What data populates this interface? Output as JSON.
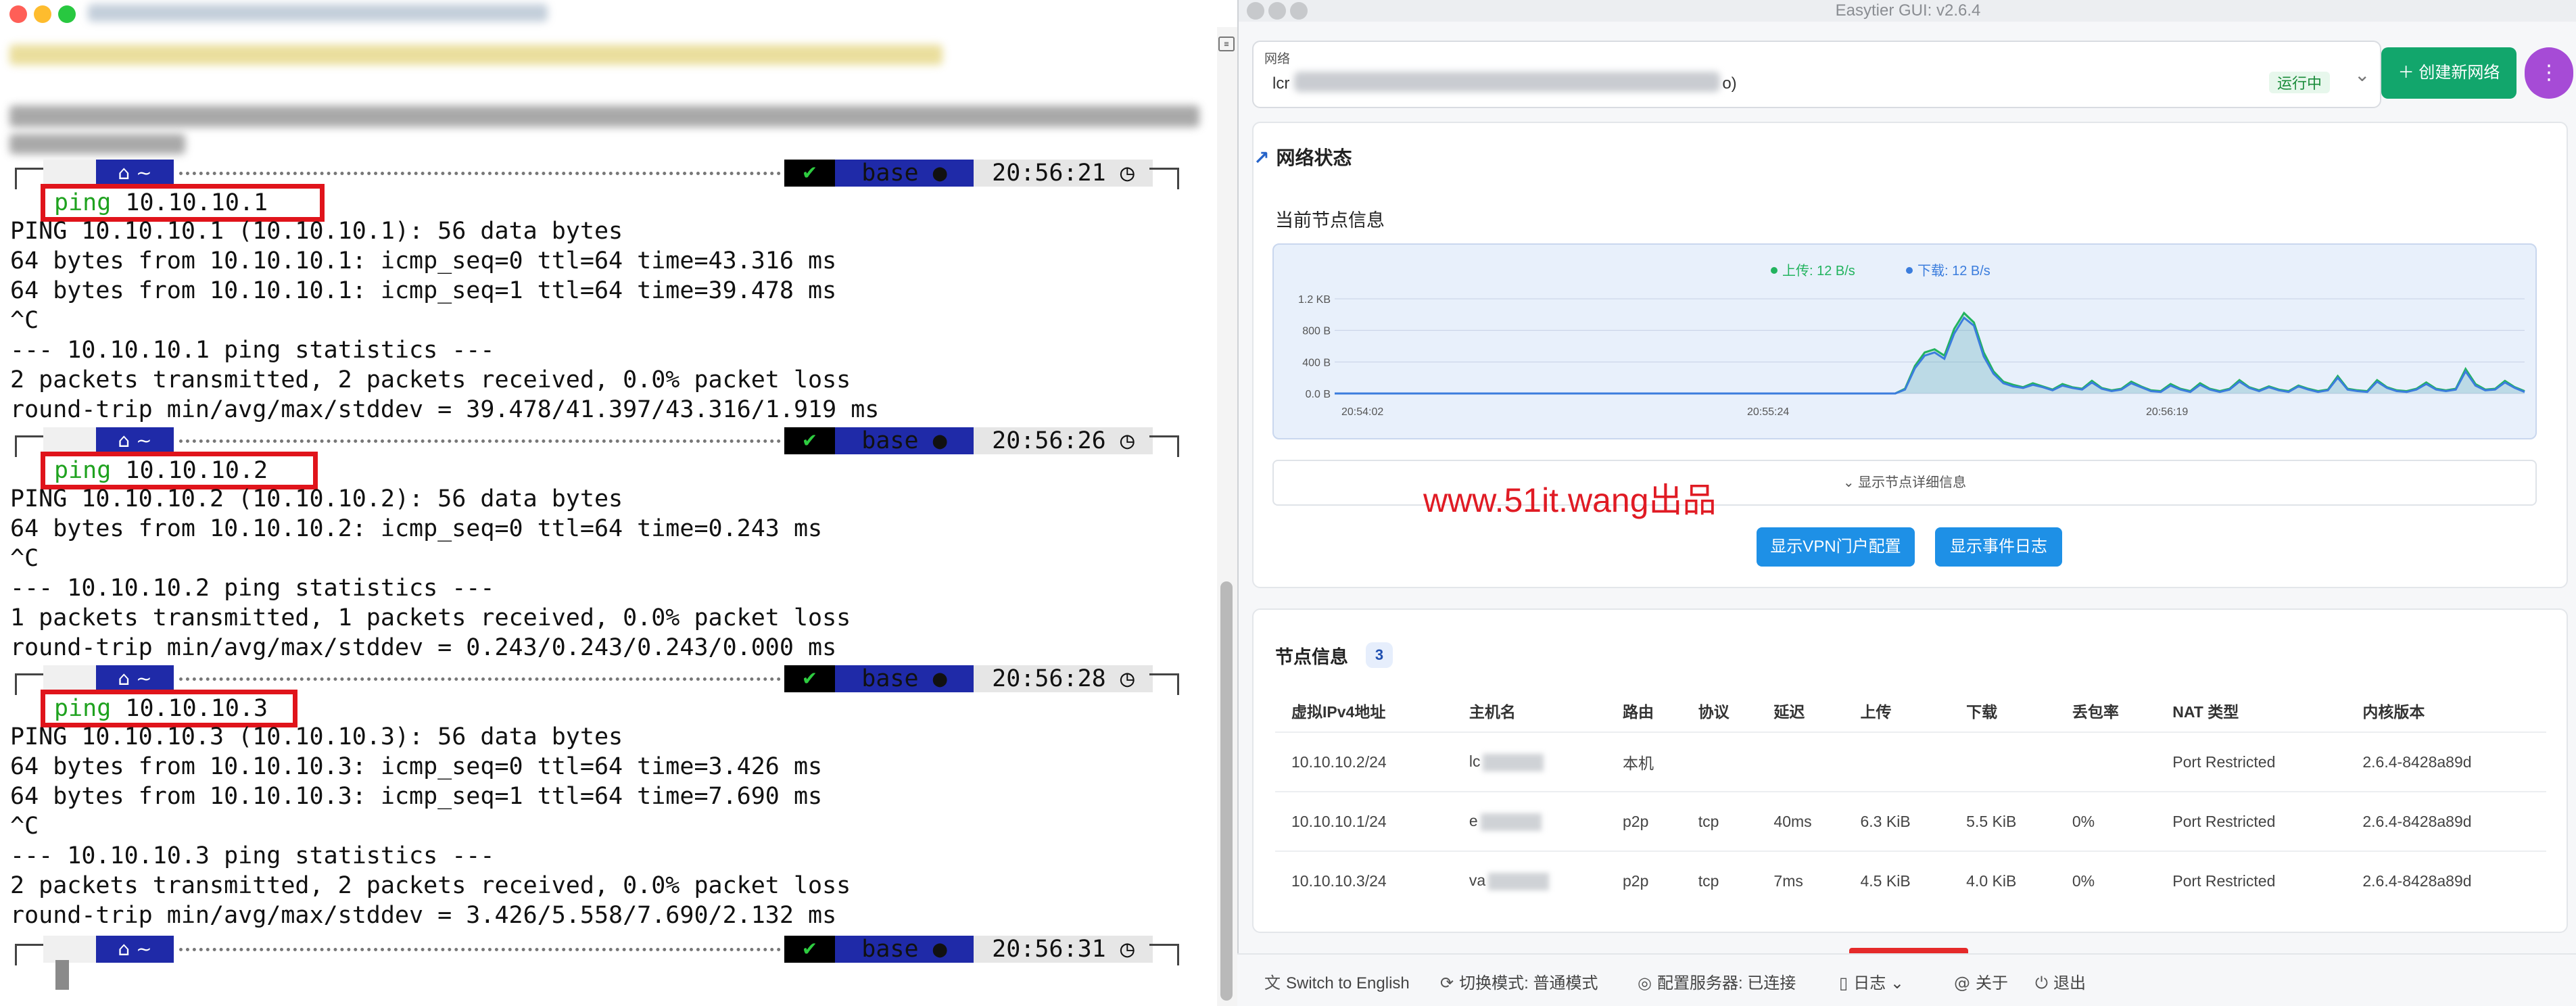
{
  "terminal": {
    "blocks": [
      {
        "time": "20:56:21",
        "cmd_kw": "ping",
        "cmd_arg": "10.10.10.1",
        "output": [
          "PING 10.10.10.1 (10.10.10.1): 56 data bytes",
          "64 bytes from 10.10.10.1: icmp_seq=0 ttl=64 time=43.316 ms",
          "64 bytes from 10.10.10.1: icmp_seq=1 ttl=64 time=39.478 ms",
          "^C",
          "--- 10.10.10.1 ping statistics ---",
          "2 packets transmitted, 2 packets received, 0.0% packet loss",
          "round-trip min/avg/max/stddev = 39.478/41.397/43.316/1.919 ms"
        ]
      },
      {
        "time": "20:56:26",
        "cmd_kw": "ping",
        "cmd_arg": "10.10.10.2",
        "output": [
          "PING 10.10.10.2 (10.10.10.2): 56 data bytes",
          "64 bytes from 10.10.10.2: icmp_seq=0 ttl=64 time=0.243 ms",
          "^C",
          "--- 10.10.10.2 ping statistics ---",
          "1 packets transmitted, 1 packets received, 0.0% packet loss",
          "round-trip min/avg/max/stddev = 0.243/0.243/0.243/0.000 ms"
        ]
      },
      {
        "time": "20:56:28",
        "cmd_kw": "ping",
        "cmd_arg": "10.10.10.3",
        "output": [
          "PING 10.10.10.3 (10.10.10.3): 56 data bytes",
          "64 bytes from 10.10.10.3: icmp_seq=0 ttl=64 time=3.426 ms",
          "64 bytes from 10.10.10.3: icmp_seq=1 ttl=64 time=7.690 ms",
          "^C",
          "--- 10.10.10.3 ping statistics ---",
          "2 packets transmitted, 2 packets received, 0.0% packet loss",
          "round-trip min/avg/max/stddev = 3.426/5.558/7.690/2.132 ms"
        ]
      }
    ],
    "last_prompt_time": "20:56:31",
    "prompt": {
      "apple": "",
      "home": "⌂ ~",
      "check": "✔",
      "env": "base ●",
      "clock": "◷"
    }
  },
  "gui": {
    "window_title": "Easytier GUI: v2.6.4",
    "network": {
      "label": "网络",
      "value_prefix": "lcr",
      "value_suffix": "o)",
      "status": "运行中"
    },
    "create_button": "创建新网络",
    "more_button": "⋮",
    "net_status_title": "网络状态",
    "current_node_title": "当前节点信息",
    "detail_toggle": "显示节点详细信息",
    "vpn_button": "显示VPN门户配置",
    "events_button": "显示事件日志",
    "watermark": "www.51it.wang出品",
    "nodes_title": "节点信息",
    "nodes_count": "3",
    "table": {
      "headers": [
        "虚拟IPv4地址",
        "主机名",
        "路由",
        "协议",
        "延迟",
        "上传",
        "下载",
        "丢包率",
        "NAT 类型",
        "内核版本"
      ],
      "rows": [
        [
          "10.10.10.2/24",
          "lc",
          "本机",
          "",
          "",
          "",
          "",
          "",
          "Port Restricted",
          "2.6.4-8428a89d"
        ],
        [
          "10.10.10.1/24",
          "e",
          "p2p",
          "tcp",
          "40ms",
          "6.3 KiB",
          "5.5 KiB",
          "0%",
          "Port Restricted",
          "2.6.4-8428a89d"
        ],
        [
          "10.10.10.3/24",
          "va",
          "p2p",
          "tcp",
          "7ms",
          "4.5 KiB",
          "4.0 KiB",
          "0%",
          "Port Restricted",
          "2.6.4-8428a89d"
        ]
      ]
    },
    "footer": [
      {
        "icon": "translate-icon",
        "glyph": "文",
        "label": "Switch to English"
      },
      {
        "icon": "refresh-icon",
        "glyph": "⟳",
        "label": "切换模式: 普通模式"
      },
      {
        "icon": "globe-icon",
        "glyph": "◎",
        "label": "配置服务器: 已连接"
      },
      {
        "icon": "file-icon",
        "glyph": "▯",
        "label": "日志 ⌄"
      },
      {
        "icon": "at-icon",
        "glyph": "@",
        "label": "关于"
      },
      {
        "icon": "power-icon",
        "glyph": "⏻",
        "label": "退出"
      }
    ],
    "chart": {
      "legend_up": "上传: 12 B/s",
      "legend_down": "下载: 12 B/s"
    }
  },
  "chart_data": {
    "type": "line",
    "title": "",
    "xlabel": "",
    "ylabel": "",
    "x_ticks": [
      "20:54:02",
      "20:55:24",
      "20:56:19"
    ],
    "y_ticks": [
      "0.0 B",
      "400 B",
      "800 B",
      "1.2 KB"
    ],
    "ylim": [
      0,
      1200
    ],
    "colors": {
      "up": "#22b35e",
      "down": "#3b7ddd"
    },
    "series": [
      {
        "name": "上传: 12 B/s",
        "values": [
          0,
          0,
          0,
          0,
          0,
          0,
          0,
          0,
          0,
          0,
          0,
          0,
          0,
          0,
          0,
          0,
          0,
          0,
          0,
          0,
          0,
          0,
          0,
          0,
          0,
          0,
          0,
          0,
          0,
          0,
          0,
          0,
          0,
          0,
          0,
          0,
          0,
          0,
          0,
          0,
          0,
          0,
          0,
          0,
          0,
          0,
          0,
          0,
          0,
          0,
          0,
          0,
          0,
          0,
          0,
          0,
          0,
          0,
          60,
          350,
          520,
          560,
          480,
          820,
          1020,
          900,
          520,
          280,
          150,
          110,
          80,
          130,
          90,
          50,
          120,
          80,
          60,
          160,
          70,
          40,
          60,
          150,
          90,
          40,
          30,
          120,
          60,
          30,
          130,
          60,
          30,
          60,
          170,
          80,
          40,
          90,
          50,
          30,
          100,
          60,
          30,
          50,
          220,
          60,
          40,
          30,
          170,
          80,
          40,
          30,
          60,
          140,
          60,
          40,
          60,
          310,
          120,
          50,
          60,
          160,
          80,
          30
        ]
      },
      {
        "name": "下载: 12 B/s",
        "values": [
          0,
          0,
          0,
          0,
          0,
          0,
          0,
          0,
          0,
          0,
          0,
          0,
          0,
          0,
          0,
          0,
          0,
          0,
          0,
          0,
          0,
          0,
          0,
          0,
          0,
          0,
          0,
          0,
          0,
          0,
          0,
          0,
          0,
          0,
          0,
          0,
          0,
          0,
          0,
          0,
          0,
          0,
          0,
          0,
          0,
          0,
          0,
          0,
          0,
          0,
          0,
          0,
          0,
          0,
          0,
          0,
          0,
          0,
          50,
          320,
          480,
          520,
          440,
          760,
          960,
          860,
          470,
          250,
          130,
          90,
          70,
          110,
          80,
          40,
          100,
          70,
          50,
          140,
          60,
          30,
          50,
          130,
          80,
          30,
          20,
          100,
          50,
          20,
          110,
          50,
          20,
          50,
          150,
          70,
          30,
          80,
          40,
          20,
          90,
          50,
          20,
          40,
          200,
          50,
          30,
          20,
          150,
          70,
          30,
          20,
          50,
          120,
          50,
          30,
          50,
          280,
          100,
          40,
          50,
          140,
          70,
          20
        ]
      }
    ]
  }
}
